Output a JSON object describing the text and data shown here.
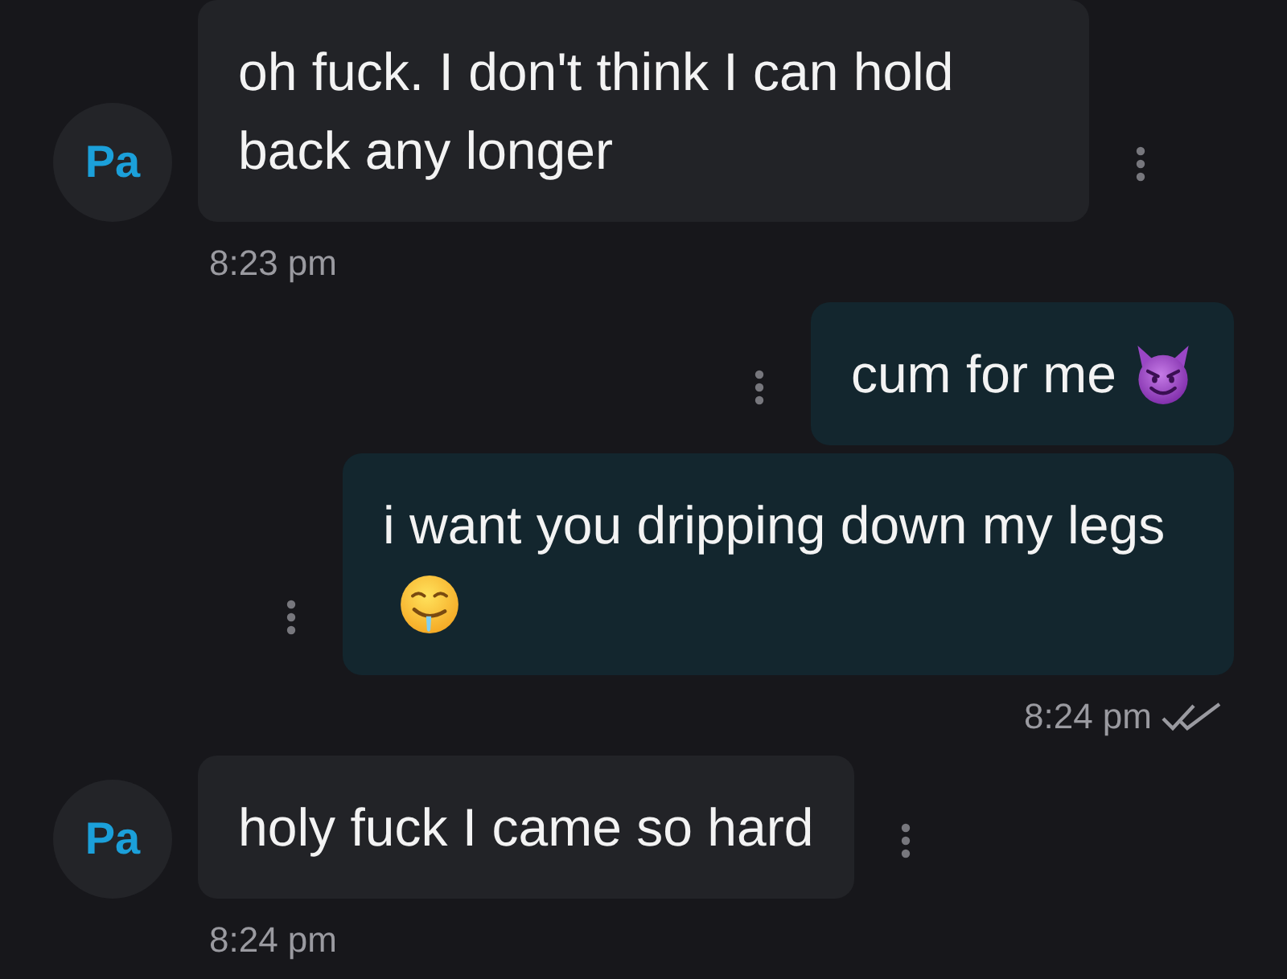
{
  "conversation": [
    {
      "kind": "incoming",
      "avatar": "Pa",
      "messages": [
        {
          "text": "oh fuck. I don't think I can hold back any longer"
        }
      ],
      "time": "8:23 pm"
    },
    {
      "kind": "outgoing",
      "messages": [
        {
          "text": "cum for me",
          "emoji": {
            "kind": "imp"
          }
        },
        {
          "text": "i want you dripping down my legs",
          "emoji": {
            "kind": "drool"
          }
        }
      ],
      "time": "8:24 pm",
      "read": true
    },
    {
      "kind": "incoming",
      "avatar": "Pa",
      "messages": [
        {
          "text": "holy fuck I came so hard"
        }
      ],
      "time": "8:24 pm"
    }
  ]
}
